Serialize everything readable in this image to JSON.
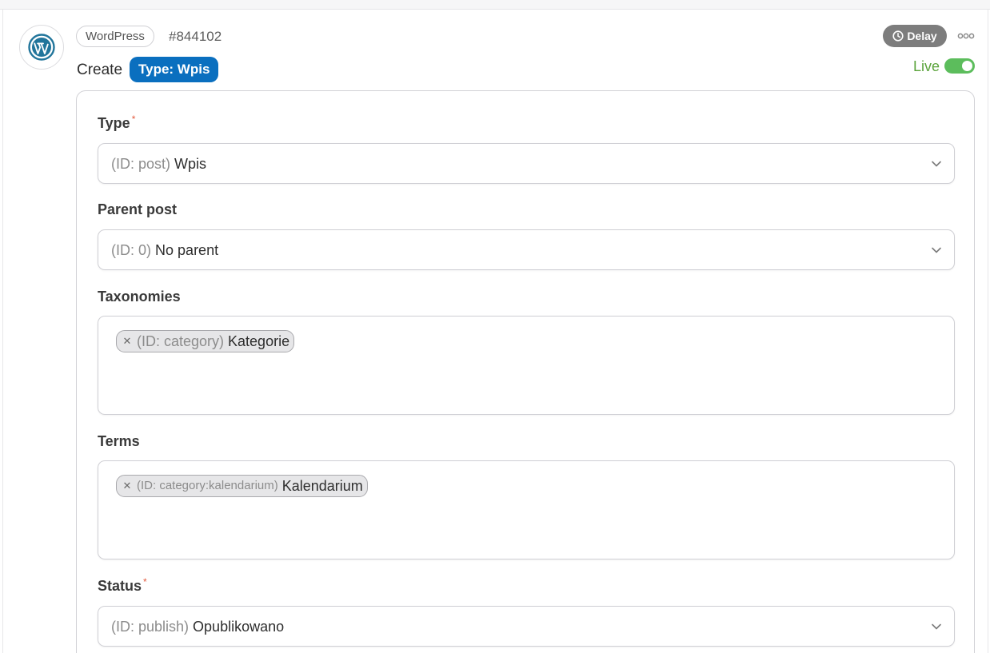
{
  "step": {
    "app_name": "WordPress",
    "id": "#844102",
    "action": "Create",
    "type_badge": "Type: Wpis",
    "delay_label": "Delay",
    "live_label": "Live",
    "live_enabled": true
  },
  "fields": {
    "type": {
      "label": "Type",
      "required": "*",
      "id_prefix": "(ID: post)",
      "value": "Wpis"
    },
    "parent_post": {
      "label": "Parent post",
      "id_prefix": "(ID: 0)",
      "value": "No parent"
    },
    "taxonomies": {
      "label": "Taxonomies",
      "tags": [
        {
          "id_prefix": "(ID: category)",
          "value": "Kategorie"
        }
      ]
    },
    "terms": {
      "label": "Terms",
      "tags": [
        {
          "id_prefix": "(ID: category:kalendarium)",
          "value": "Kalendarium"
        }
      ]
    },
    "status": {
      "label": "Status",
      "required": "*",
      "id_prefix": "(ID: publish)",
      "value": "Opublikowano"
    }
  },
  "icons": {
    "app_logo": "wordpress-logo",
    "delay": "clock-icon",
    "more": "ellipsis-icon",
    "select": "chevron-down-icon",
    "tag_remove": "close-icon"
  },
  "colors": {
    "type_badge_bg": "#0a6fbf",
    "delay_bg": "#7d7d7d",
    "live_green": "#5cbd5c",
    "required_star": "#e35b3f"
  }
}
